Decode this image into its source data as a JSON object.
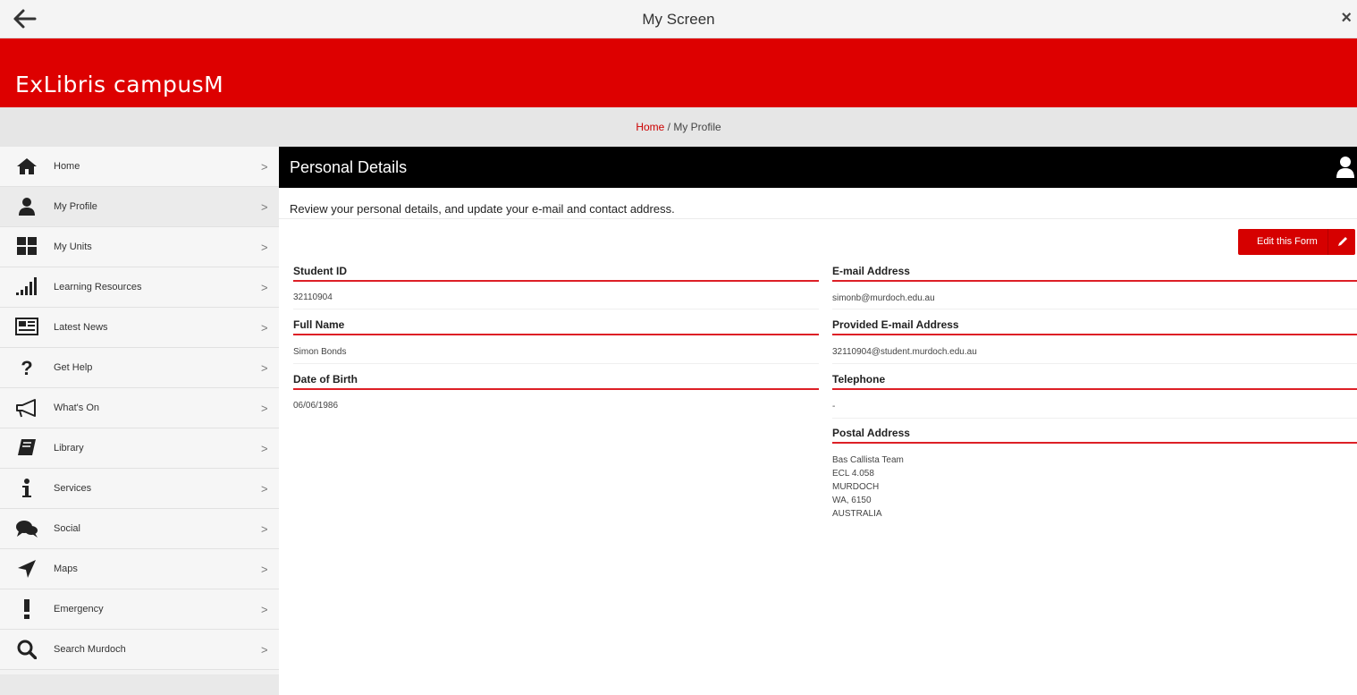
{
  "window": {
    "title": "My Screen",
    "back_icon": "arrow-left-icon",
    "close_label": "×"
  },
  "brand": {
    "logo_text": "ExLibris campusM",
    "color": "#dd0000"
  },
  "breadcrumb": {
    "home": "Home",
    "separator": " / ",
    "current": "My Profile"
  },
  "sidebar": {
    "chevron": ">",
    "items": [
      {
        "label": "Home",
        "icon": "home-icon",
        "glyph": "🏠"
      },
      {
        "label": "My Profile",
        "icon": "user-icon",
        "glyph": "👤",
        "active": true
      },
      {
        "label": "My Units",
        "icon": "grid-icon",
        "glyph": "▦"
      },
      {
        "label": "Learning Resources",
        "icon": "signal-bars-icon",
        "glyph": "📶"
      },
      {
        "label": "Latest News",
        "icon": "newspaper-icon",
        "glyph": "📰"
      },
      {
        "label": "Get Help",
        "icon": "question-icon",
        "glyph": "?"
      },
      {
        "label": "What's On",
        "icon": "megaphone-icon",
        "glyph": "📢"
      },
      {
        "label": "Library",
        "icon": "book-icon",
        "glyph": "📕"
      },
      {
        "label": "Services",
        "icon": "info-icon",
        "glyph": "ℹ"
      },
      {
        "label": "Social",
        "icon": "chat-icon",
        "glyph": "💬"
      },
      {
        "label": "Maps",
        "icon": "location-arrow-icon",
        "glyph": "➤"
      },
      {
        "label": "Emergency",
        "icon": "exclamation-icon",
        "glyph": "!"
      },
      {
        "label": "Search Murdoch",
        "icon": "search-icon",
        "glyph": "🔍"
      }
    ]
  },
  "panel": {
    "title": "Personal Details",
    "icon": "user-icon",
    "intro": "Review your personal details, and update your e-mail and contact address.",
    "edit_button": "Edit this Form",
    "edit_icon": "pencil-icon"
  },
  "fields": {
    "student_id": {
      "label": "Student ID",
      "value": "32110904"
    },
    "full_name": {
      "label": "Full Name",
      "value": "Simon Bonds"
    },
    "dob": {
      "label": "Date of Birth",
      "value": "06/06/1986"
    },
    "email": {
      "label": "E-mail Address",
      "value": "simonb@murdoch.edu.au"
    },
    "provided_email": {
      "label": "Provided E-mail Address",
      "value": "32110904@student.murdoch.edu.au"
    },
    "telephone": {
      "label": "Telephone",
      "value": "-"
    },
    "postal": {
      "label": "Postal Address",
      "lines": [
        "Bas Callista Team",
        "ECL 4.058",
        "MURDOCH",
        "WA, 6150",
        "AUSTRALIA"
      ]
    }
  }
}
